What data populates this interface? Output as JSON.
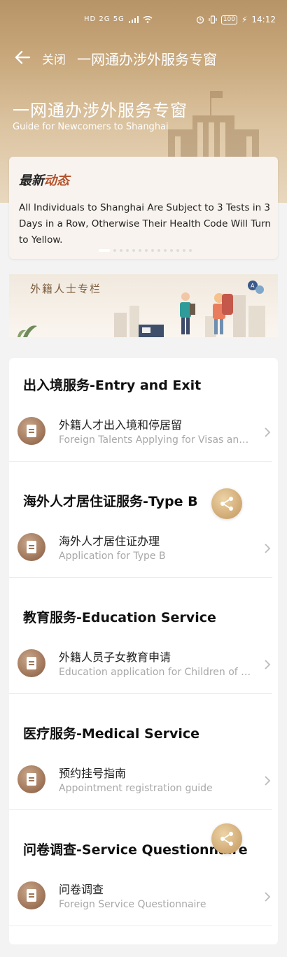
{
  "status_bar": {
    "left_indicators": "HD 2G 5G",
    "battery": "100",
    "time": "14:12"
  },
  "nav": {
    "close_label": "关闭",
    "title": "一网通办涉外服务专窗"
  },
  "hero": {
    "title": "一网通办涉外服务专窗",
    "subtitle": "Guide for Newcomers to Shanghai"
  },
  "news": {
    "heading_part1": "最新",
    "heading_part2": "动态",
    "text": "All Individuals to Shanghai Are Subject to 3 Tests in 3 Days in a Row, Otherwise Their Health Code Will Turn to Yellow."
  },
  "banner": {
    "label": "外籍人士专栏"
  },
  "sections": [
    {
      "title": "出入境服务-Entry and Exit",
      "items": [
        {
          "title": "外籍人才出入境和停居留",
          "subtitle": "Foreign Talents Applying for Visas and Residence Permits"
        }
      ]
    },
    {
      "title": "海外人才居住证服务-Type B",
      "items": [
        {
          "title": "海外人才居住证办理",
          "subtitle": "Application for Type B"
        }
      ]
    },
    {
      "title": "教育服务-Education Service",
      "items": [
        {
          "title": "外籍人员子女教育申请",
          "subtitle": "Education application for Children of Foreigners"
        }
      ]
    },
    {
      "title": "医疗服务-Medical Service",
      "items": [
        {
          "title": "预约挂号指南",
          "subtitle": "Appointment registration guide"
        }
      ]
    },
    {
      "title": "问卷调查-Service Questionnaire",
      "items": [
        {
          "title": "问卷调查",
          "subtitle": "Foreign Service Questionnaire"
        }
      ]
    }
  ],
  "colors": {
    "accent": "#b5512b",
    "gold": "#c9a97d",
    "icon_brown": "#a77d60"
  }
}
